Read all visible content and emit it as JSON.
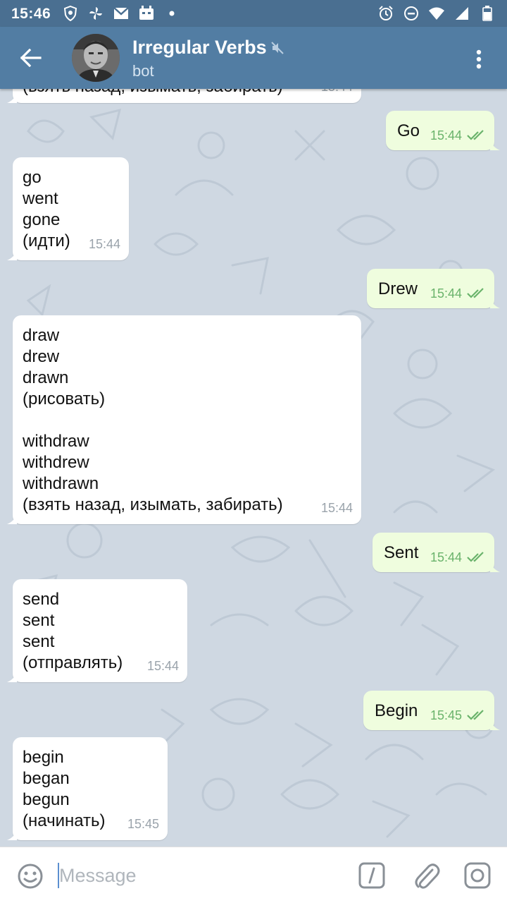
{
  "status_bar": {
    "time": "15:46"
  },
  "header": {
    "title": "Irregular Verbs",
    "subtitle": "bot"
  },
  "messages": {
    "m0": {
      "text": "(взять назад, изымать, забирать)",
      "time": "15:44"
    },
    "m1": {
      "text": "Go",
      "time": "15:44"
    },
    "m2": {
      "text": "go\nwent\ngone\n(идти)",
      "time": "15:44"
    },
    "m3": {
      "text": "Drew",
      "time": "15:44"
    },
    "m4": {
      "text": "draw\ndrew\ndrawn\n(рисовать)\n\nwithdraw\nwithdrew\nwithdrawn\n(взять назад, изымать, забирать)",
      "time": "15:44"
    },
    "m5": {
      "text": "Sent",
      "time": "15:44"
    },
    "m6": {
      "text": "send\nsent\nsent\n(отправлять)",
      "time": "15:44"
    },
    "m7": {
      "text": "Begin",
      "time": "15:45"
    },
    "m8": {
      "text": "begin\nbegan\nbegun\n(начинать)",
      "time": "15:45"
    }
  },
  "input": {
    "placeholder": "Message"
  },
  "colors": {
    "header": "#527da3",
    "status_bar": "#4a6f91",
    "chat_bg": "#cfd8e2",
    "outgoing_bubble": "#effdde",
    "incoming_bubble": "#ffffff",
    "read_check": "#6ab36b"
  }
}
